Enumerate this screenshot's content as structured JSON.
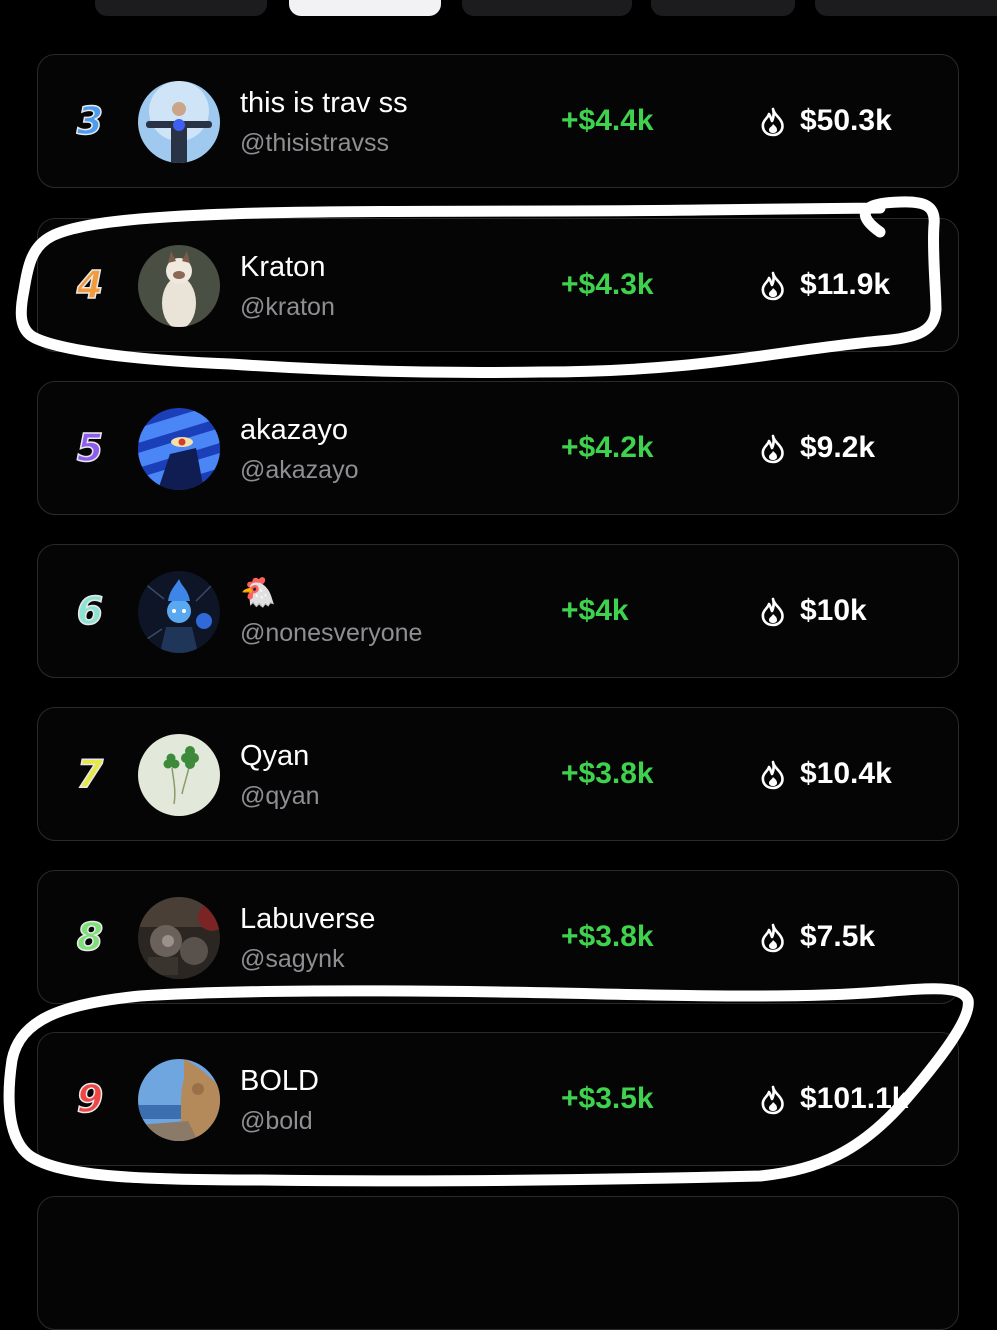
{
  "leaderboard": [
    {
      "rank": "3",
      "name": "this is trav ss",
      "handle": "@thisistravss",
      "profit": "+$4.4k",
      "volume": "$50.3k"
    },
    {
      "rank": "4",
      "name": "Kraton",
      "handle": "@kraton",
      "profit": "+$4.3k",
      "volume": "$11.9k"
    },
    {
      "rank": "5",
      "name": "akazayo",
      "handle": "@akazayo",
      "profit": "+$4.2k",
      "volume": "$9.2k"
    },
    {
      "rank": "6",
      "name": "🐔",
      "handle": "@nonesveryone",
      "profit": "+$4k",
      "volume": "$10k"
    },
    {
      "rank": "7",
      "name": "Qyan",
      "handle": "@qyan",
      "profit": "+$3.8k",
      "volume": "$10.4k"
    },
    {
      "rank": "8",
      "name": "Labuverse",
      "handle": "@sagynk",
      "profit": "+$3.8k",
      "volume": "$7.5k"
    },
    {
      "rank": "9",
      "name": "BOLD",
      "handle": "@bold",
      "profit": "+$3.5k",
      "volume": "$101.1k"
    }
  ],
  "icons": {
    "volume": "flame-icon"
  },
  "colors": {
    "background": "#000000",
    "row_border": "#2a2a2d",
    "profit": "#3fd24e",
    "handle": "#8e8e93",
    "annotation": "#ffffff"
  }
}
